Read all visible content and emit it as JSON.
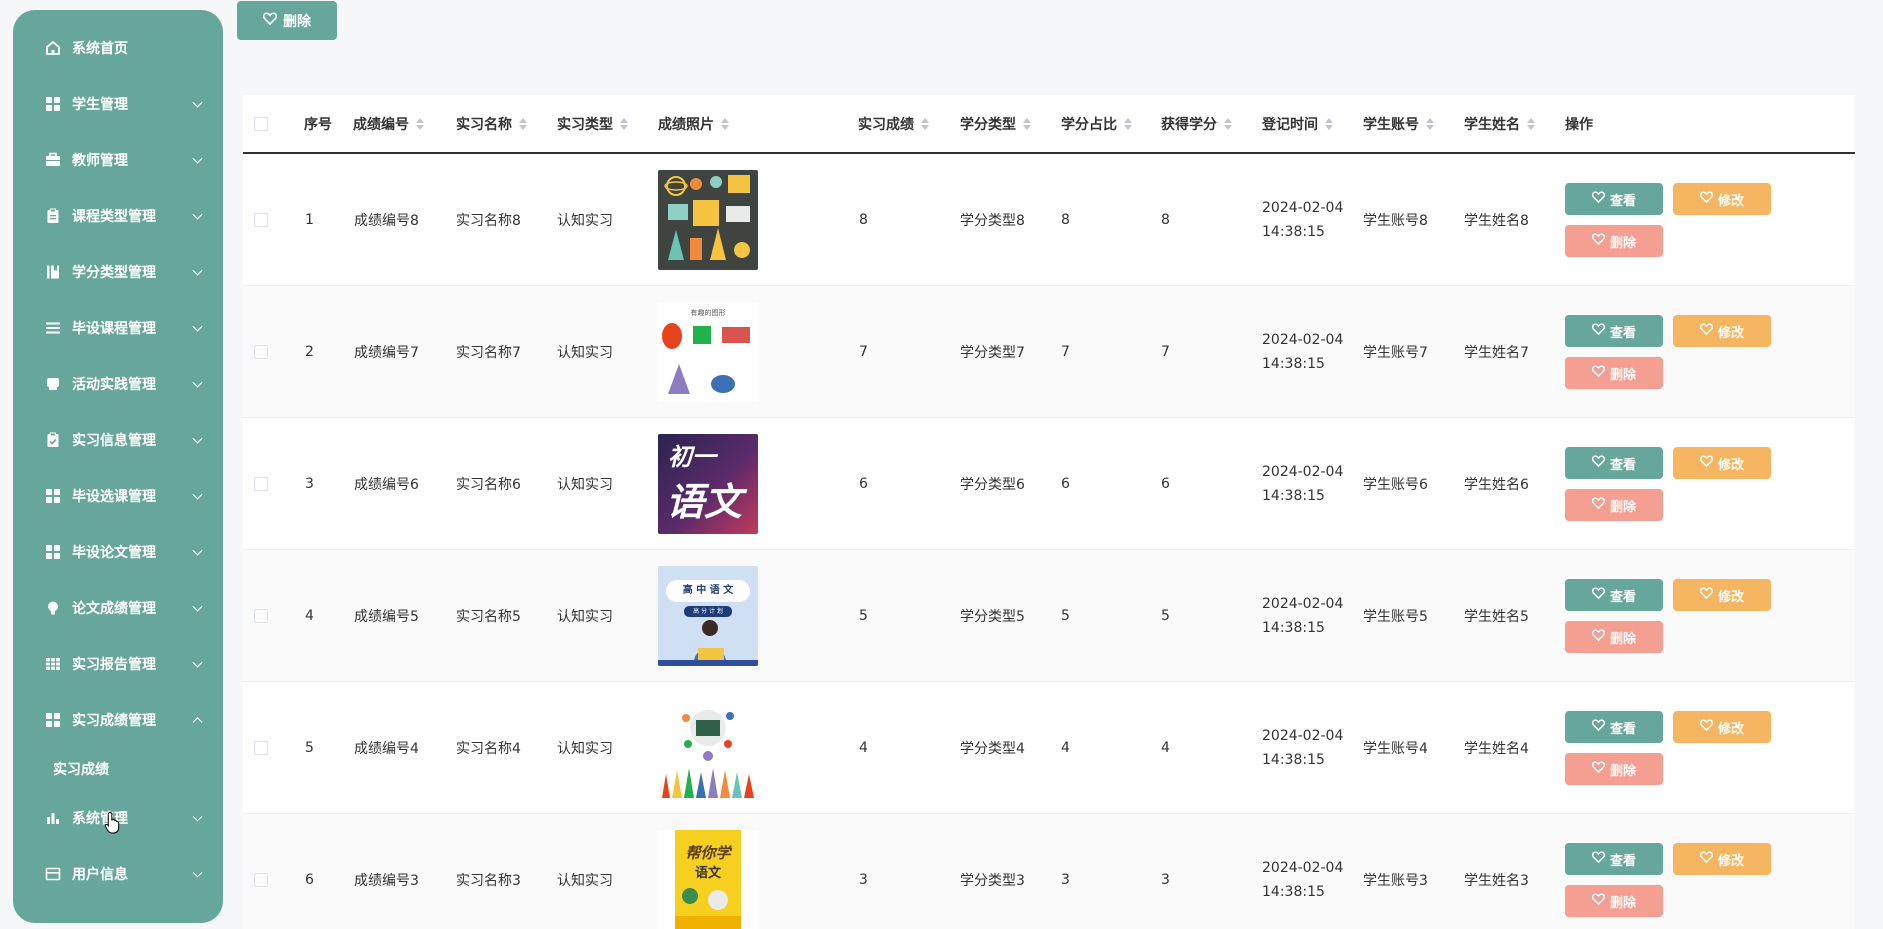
{
  "sidebar": {
    "items": [
      {
        "label": "系统首页",
        "icon": "home-icon"
      },
      {
        "label": "学生管理",
        "icon": "grid-icon"
      },
      {
        "label": "教师管理",
        "icon": "briefcase-icon"
      },
      {
        "label": "课程类型管理",
        "icon": "clipboard-icon"
      },
      {
        "label": "学分类型管理",
        "icon": "book-icon"
      },
      {
        "label": "毕设课程管理",
        "icon": "list-icon"
      },
      {
        "label": "活动实践管理",
        "icon": "print-icon"
      },
      {
        "label": "实习信息管理",
        "icon": "checklist-icon"
      },
      {
        "label": "毕设选课管理",
        "icon": "grid-icon"
      },
      {
        "label": "毕设论文管理",
        "icon": "grid-icon"
      },
      {
        "label": "论文成绩管理",
        "icon": "bulb-icon"
      },
      {
        "label": "实习报告管理",
        "icon": "table-icon"
      },
      {
        "label": "实习成绩管理",
        "icon": "grid-icon"
      },
      {
        "label": "系统管理",
        "icon": "bar-chart-icon"
      },
      {
        "label": "用户信息",
        "icon": "card-icon"
      }
    ],
    "submenu": {
      "label": "实习成绩"
    }
  },
  "toolbar": {
    "delete_label": "删除"
  },
  "table": {
    "headers": {
      "index": "序号",
      "score_no": "成绩编号",
      "intern_name": "实习名称",
      "intern_type": "实习类型",
      "photo": "成绩照片",
      "score": "实习成绩",
      "credit_type": "学分类型",
      "credit_ratio": "学分占比",
      "credit_earned": "获得学分",
      "reg_time": "登记时间",
      "student_account": "学生账号",
      "student_name": "学生姓名",
      "actions": "操作"
    },
    "actions": {
      "view": "查看",
      "edit": "修改",
      "delete": "删除"
    },
    "rows": [
      {
        "index": "1",
        "score_no": "成绩编号8",
        "intern_name": "实习名称8",
        "intern_type": "认知实习",
        "score": "8",
        "credit_type": "学分类型8",
        "credit_ratio": "8",
        "credit_earned": "8",
        "reg_date": "2024-02-04",
        "reg_clock": "14:38:15",
        "student_account": "学生账号8",
        "student_name": "学生姓名8"
      },
      {
        "index": "2",
        "score_no": "成绩编号7",
        "intern_name": "实习名称7",
        "intern_type": "认知实习",
        "score": "7",
        "credit_type": "学分类型7",
        "credit_ratio": "7",
        "credit_earned": "7",
        "reg_date": "2024-02-04",
        "reg_clock": "14:38:15",
        "student_account": "学生账号7",
        "student_name": "学生姓名7",
        "photo_text": "有趣的图形"
      },
      {
        "index": "3",
        "score_no": "成绩编号6",
        "intern_name": "实习名称6",
        "intern_type": "认知实习",
        "score": "6",
        "credit_type": "学分类型6",
        "credit_ratio": "6",
        "credit_earned": "6",
        "reg_date": "2024-02-04",
        "reg_clock": "14:38:15",
        "student_account": "学生账号6",
        "student_name": "学生姓名6",
        "photo_text_1": "初一",
        "photo_text_2": "语文"
      },
      {
        "index": "4",
        "score_no": "成绩编号5",
        "intern_name": "实习名称5",
        "intern_type": "认知实习",
        "score": "5",
        "credit_type": "学分类型5",
        "credit_ratio": "5",
        "credit_earned": "5",
        "reg_date": "2024-02-04",
        "reg_clock": "14:38:15",
        "student_account": "学生账号5",
        "student_name": "学生姓名5",
        "photo_text_1": "高 中 语 文",
        "photo_text_2": "高 分 计 划"
      },
      {
        "index": "5",
        "score_no": "成绩编号4",
        "intern_name": "实习名称4",
        "intern_type": "认知实习",
        "score": "4",
        "credit_type": "学分类型4",
        "credit_ratio": "4",
        "credit_earned": "4",
        "reg_date": "2024-02-04",
        "reg_clock": "14:38:15",
        "student_account": "学生账号4",
        "student_name": "学生姓名4"
      },
      {
        "index": "6",
        "score_no": "成绩编号3",
        "intern_name": "实习名称3",
        "intern_type": "认知实习",
        "score": "3",
        "credit_type": "学分类型3",
        "credit_ratio": "3",
        "credit_earned": "3",
        "reg_date": "2024-02-04",
        "reg_clock": "14:38:15",
        "student_account": "学生账号3",
        "student_name": "学生姓名3",
        "photo_text_1": "帮你学",
        "photo_text_2": "语文"
      }
    ]
  },
  "colors": {
    "primary": "#67a69a",
    "warning": "#f6b560",
    "danger": "#f59f92"
  }
}
